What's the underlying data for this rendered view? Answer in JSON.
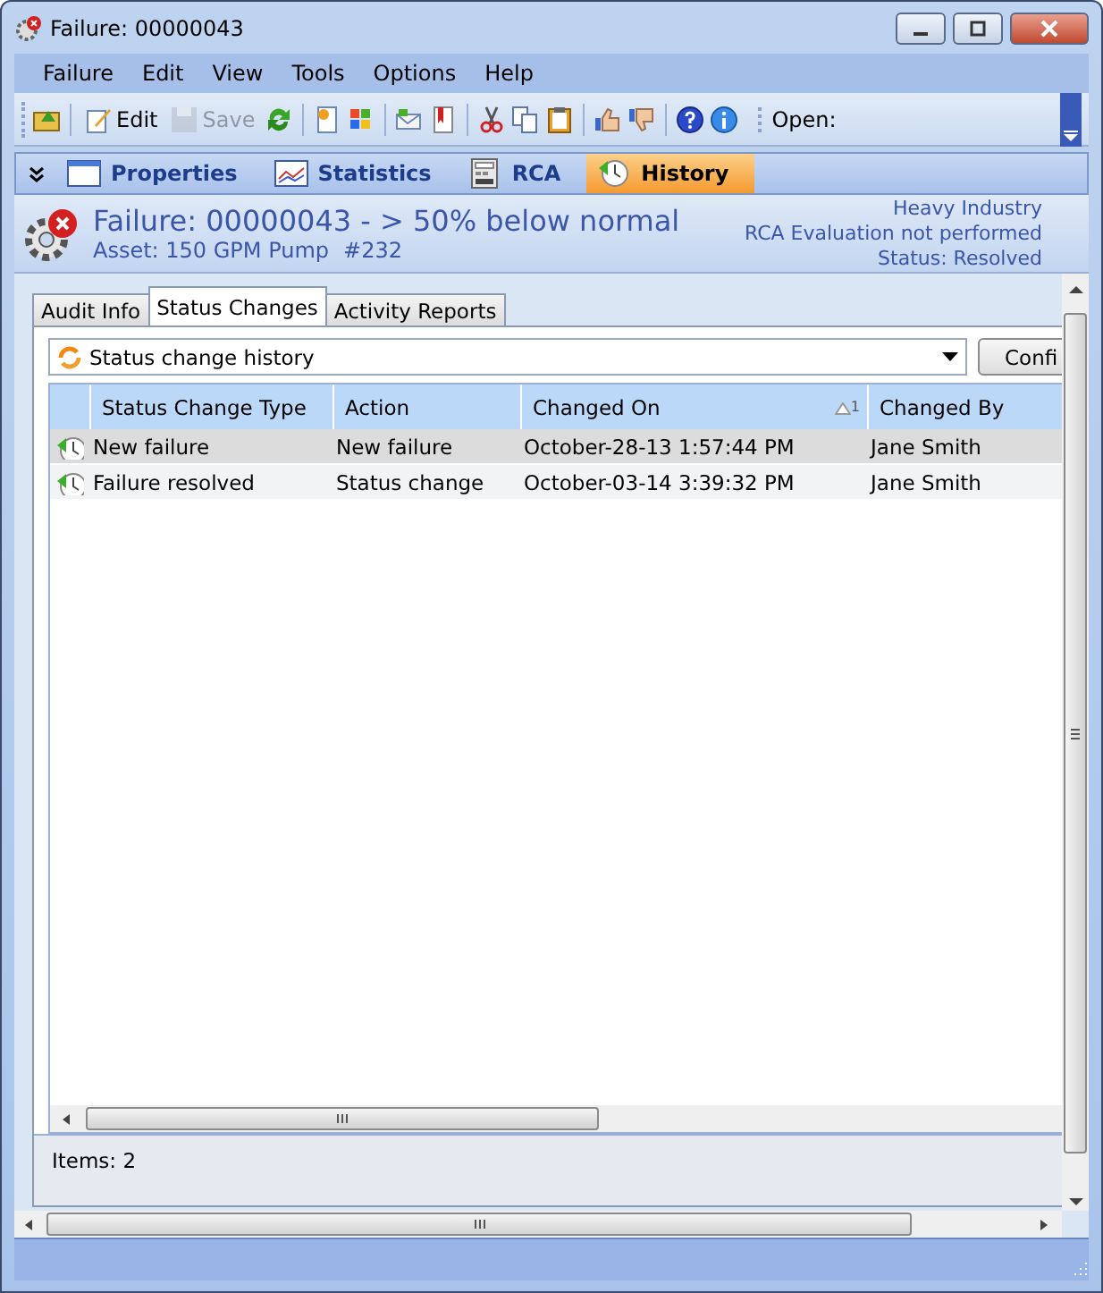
{
  "window": {
    "title": "Failure: 00000043"
  },
  "menu": [
    "Failure",
    "Edit",
    "View",
    "Tools",
    "Options",
    "Help"
  ],
  "toolbar": [
    {
      "kind": "icon"
    },
    {
      "kind": "separator"
    },
    {
      "kind": "button",
      "label": "Edit",
      "disabled": false
    },
    {
      "kind": "button",
      "label": "Save",
      "disabled": true
    },
    {
      "kind": "icon"
    },
    {
      "kind": "separator"
    },
    {
      "kind": "icon"
    },
    {
      "kind": "icon"
    },
    {
      "kind": "separator"
    },
    {
      "kind": "icon"
    },
    {
      "kind": "icon"
    },
    {
      "kind": "separator"
    },
    {
      "kind": "icon"
    },
    {
      "kind": "icon"
    },
    {
      "kind": "icon"
    },
    {
      "kind": "separator"
    },
    {
      "kind": "icon"
    },
    {
      "kind": "icon"
    },
    {
      "kind": "separator"
    },
    {
      "kind": "icon"
    },
    {
      "kind": "icon"
    }
  ],
  "open_label": "Open:",
  "nav_tabs": [
    {
      "label": "Properties",
      "selected": false
    },
    {
      "label": "Statistics",
      "selected": false
    },
    {
      "label": "RCA",
      "selected": false
    },
    {
      "label": "History",
      "selected": true
    }
  ],
  "header": {
    "title": "Failure: 00000043 - > 50% below normal",
    "asset": "Asset: 150 GPM Pump",
    "asset_number": "#232",
    "info": [
      "Heavy Industry",
      "RCA Evaluation not performed",
      "Status: Resolved"
    ]
  },
  "sub_tabs": [
    {
      "label": "Audit Info",
      "selected": false
    },
    {
      "label": "Status Changes",
      "selected": true
    },
    {
      "label": "Activity Reports",
      "selected": false
    }
  ],
  "view_select": {
    "value": "Status change history"
  },
  "config_button": "Confi",
  "table": {
    "columns": [
      {
        "label": "Status Change Type"
      },
      {
        "label": "Action"
      },
      {
        "label": "Changed On",
        "sort_index": "1"
      },
      {
        "label": "Changed By"
      }
    ],
    "rows": [
      {
        "selected": true,
        "cells": [
          "New failure",
          "New failure",
          "October-28-13 1:57:44 PM",
          "Jane Smith"
        ]
      },
      {
        "selected": false,
        "cells": [
          "Failure resolved",
          "Status change",
          "October-03-14 3:39:32 PM",
          "Jane Smith"
        ]
      }
    ]
  },
  "items_count": "Items: 2"
}
